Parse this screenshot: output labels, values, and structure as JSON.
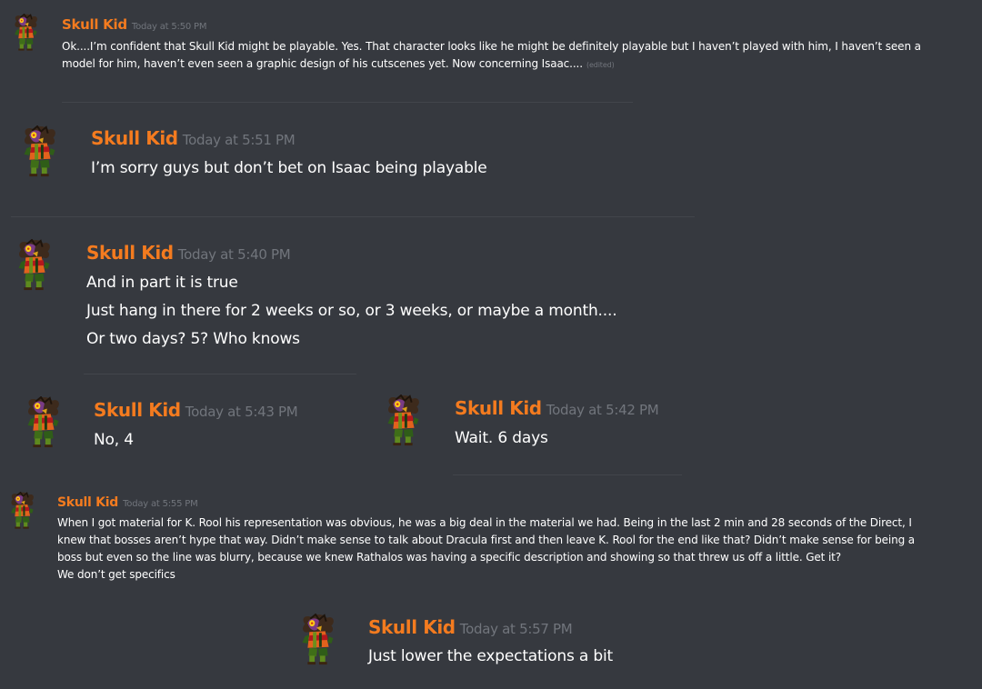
{
  "colors": {
    "background": "#36393f",
    "author": "#f47b1f",
    "timestamp": "#71757c",
    "text": "#ffffff",
    "divider": "#42454b"
  },
  "messages": [
    {
      "author": "Skull Kid",
      "timestamp": "Today at 5:50 PM",
      "lines": [
        "Ok....I’m confident that Skull Kid might be playable. Yes. That character looks like he might be definitely playable but I haven’t played with him, I haven’t seen a",
        "model for him, haven’t even seen a graphic design of his cutscenes yet. Now concerning Isaac...."
      ],
      "edited": "(edited)",
      "avatar_icon": "skull-kid-avatar"
    },
    {
      "author": "Skull Kid",
      "timestamp": "Today at 5:51 PM",
      "lines": [
        "I’m sorry guys but don’t bet on Isaac being playable"
      ],
      "avatar_icon": "skull-kid-avatar"
    },
    {
      "author": "Skull Kid",
      "timestamp": "Today at 5:40 PM",
      "lines": [
        "And in part it is true",
        "Just hang in there for 2 weeks or so, or 3 weeks, or maybe a month....",
        "Or two days? 5? Who knows"
      ],
      "avatar_icon": "skull-kid-avatar"
    },
    {
      "author": "Skull Kid",
      "timestamp": "Today at 5:43 PM",
      "lines": [
        "No, 4"
      ],
      "avatar_icon": "skull-kid-avatar"
    },
    {
      "author": "Skull Kid",
      "timestamp": "Today at 5:42 PM",
      "lines": [
        "Wait. 6 days"
      ],
      "avatar_icon": "skull-kid-avatar"
    },
    {
      "author": "Skull Kid",
      "timestamp": "Today at 5:55 PM",
      "lines": [
        "When I got material for K. Rool his representation was obvious, he was a big deal in the material we had. Being in the last 2 min and 28 seconds of the Direct, I",
        "knew that bosses aren’t hype that way. Didn’t make sense to talk about Dracula first and then leave K. Rool for the end like that? Didn’t make sense for being a",
        "boss but even so the line was blurry, because we knew Rathalos was having a specific description and showing so that threw us off a little. Get it?",
        "We don’t get specifics"
      ],
      "avatar_icon": "skull-kid-avatar"
    },
    {
      "author": "Skull Kid",
      "timestamp": "Today at 5:57 PM",
      "lines": [
        "Just lower the expectations a bit"
      ],
      "avatar_icon": "skull-kid-avatar"
    }
  ]
}
